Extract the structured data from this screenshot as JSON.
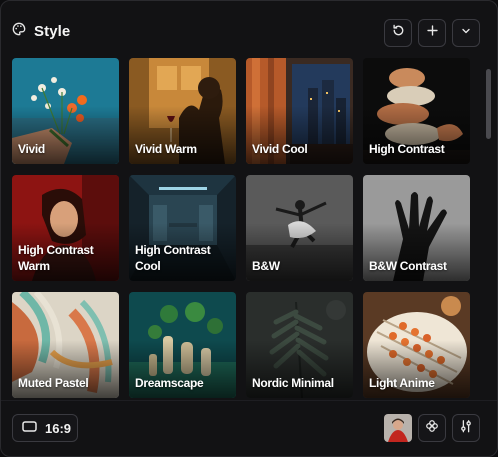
{
  "header": {
    "title": "Style"
  },
  "styles": [
    {
      "label": "Vivid"
    },
    {
      "label": "Vivid Warm"
    },
    {
      "label": "Vivid Cool"
    },
    {
      "label": "High Contrast"
    },
    {
      "label": "High Contrast\nWarm"
    },
    {
      "label": "High Contrast\nCool"
    },
    {
      "label": "B&W"
    },
    {
      "label": "B&W Contrast"
    },
    {
      "label": "Muted Pastel"
    },
    {
      "label": "Dreamscape"
    },
    {
      "label": "Nordic Minimal"
    },
    {
      "label": "Light Anime"
    }
  ],
  "footer": {
    "aspect_ratio": "16:9"
  },
  "icons": {
    "title": "palette-icon",
    "reset": "rotate-ccw-icon",
    "add": "plus-icon",
    "collapse": "chevron-down-icon",
    "ratio": "rectangle-icon",
    "grid": "flower-icon",
    "settings": "sliders-icon"
  }
}
